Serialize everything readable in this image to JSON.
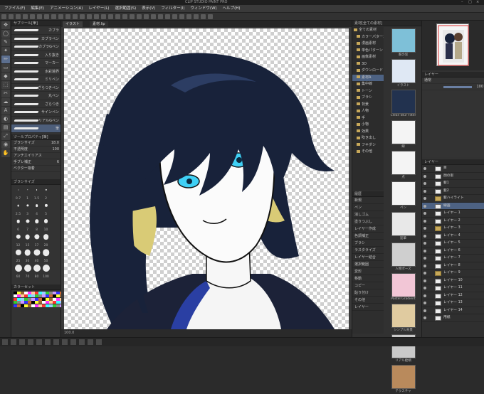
{
  "app": {
    "title": "CLIP STUDIO PAINT PRO",
    "window_controls": [
      "–",
      "□",
      "×"
    ]
  },
  "menu": [
    "ファイル(F)",
    "編集(E)",
    "アニメーション(A)",
    "レイヤー(L)",
    "選択範囲(S)",
    "表示(V)",
    "フィルター(I)",
    "ウィンドウ(W)",
    "ヘルプ(H)"
  ],
  "subtool": {
    "header": "サブツール[筆]",
    "brushes": [
      "カブラ",
      "カブラペン",
      "カブラGペン",
      "入り抜き",
      "マーカー",
      "水彩境界",
      "ミリペン",
      "ざらつきペン",
      "丸ペン",
      "ざらつき",
      "サインペン",
      "リアルGペン",
      "筆"
    ],
    "selected_index": 12,
    "property_header": "ツールプロパティ[筆]",
    "props": [
      {
        "label": "ブラシサイズ",
        "value": "18.0"
      },
      {
        "label": "不透明度",
        "value": "100"
      },
      {
        "label": "アンチエイリアス",
        "value": ""
      },
      {
        "label": "手ブレ補正",
        "value": "6"
      },
      {
        "label": "ベクター吸着",
        "value": ""
      }
    ],
    "size_header": "ブラシサイズ",
    "sizes": [
      "0.7",
      "1",
      "1.5",
      "2",
      "2.5",
      "3",
      "4",
      "5",
      "6",
      "7",
      "8",
      "10",
      "12",
      "15",
      "17",
      "20",
      "25",
      "30",
      "40",
      "50",
      "60",
      "70",
      "80",
      "100"
    ],
    "swatch_header": "カラーセット"
  },
  "canvas": {
    "tabs": [
      "イラスト",
      "素材.lip"
    ],
    "status": "100.0"
  },
  "material": {
    "header": "素材[全ての素材]",
    "tree": [
      "全ての素材",
      "カラーパターン",
      "漫画素材",
      "単色パターン",
      "画像素材",
      "3D",
      "ダウンロード",
      "素材A",
      "集中線",
      "トーン",
      "ブラシ",
      "背景",
      "人物",
      "手",
      "小物",
      "効果",
      "吹き出し",
      "フキダシ",
      "その他"
    ],
    "selected_tree_index": 7,
    "thumb_labels": [
      "家の窓",
      "イラスト",
      "Clean Blur Filter",
      "線",
      "点",
      "ペン",
      "鉛筆",
      "人物ポーズ",
      "Pastel Gradient",
      "シンプル背景",
      "リアル絵柄",
      "テクスチャ"
    ],
    "history_header": "履歴",
    "history": [
      "新規",
      "ペン",
      "消しゴム",
      "塗りつぶし",
      "レイヤー作成",
      "色調補正",
      "ブラシ",
      "ラスタライズ",
      "レイヤー結合",
      "選択範囲",
      "変形",
      "移動",
      "コピー",
      "貼り付け",
      "その他",
      "レイヤー"
    ]
  },
  "layers": {
    "header": "レイヤー",
    "blend": "通常",
    "opacity": "100",
    "items": [
      {
        "name": "目",
        "type": "layer"
      },
      {
        "name": "顔の影",
        "type": "layer"
      },
      {
        "name": "髪1",
        "type": "layer"
      },
      {
        "name": "髪2",
        "type": "layer"
      },
      {
        "name": "髪ハイライト",
        "type": "folder"
      },
      {
        "name": "線画",
        "type": "layer"
      },
      {
        "name": "レイヤー 1",
        "type": "layer"
      },
      {
        "name": "レイヤー 2",
        "type": "layer"
      },
      {
        "name": "レイヤー 3",
        "type": "folder"
      },
      {
        "name": "レイヤー 4",
        "type": "layer"
      },
      {
        "name": "レイヤー 5",
        "type": "layer"
      },
      {
        "name": "レイヤー 6",
        "type": "layer"
      },
      {
        "name": "レイヤー 7",
        "type": "layer"
      },
      {
        "name": "レイヤー 8",
        "type": "layer"
      },
      {
        "name": "レイヤー 9",
        "type": "folder"
      },
      {
        "name": "レイヤー 10",
        "type": "layer"
      },
      {
        "name": "レイヤー 11",
        "type": "layer"
      },
      {
        "name": "レイヤー 12",
        "type": "layer"
      },
      {
        "name": "レイヤー 13",
        "type": "layer"
      },
      {
        "name": "レイヤー 14",
        "type": "layer"
      },
      {
        "name": "用紙",
        "type": "layer"
      }
    ],
    "selected_index": 5
  },
  "colors": {
    "hair": "#18223a",
    "hair_highlight": "#2c3d63",
    "hair_tips": "#d9cb76",
    "skin": "#fbfbfb",
    "eye": "#3fd0f5",
    "accent_selected": "#4d6283"
  }
}
